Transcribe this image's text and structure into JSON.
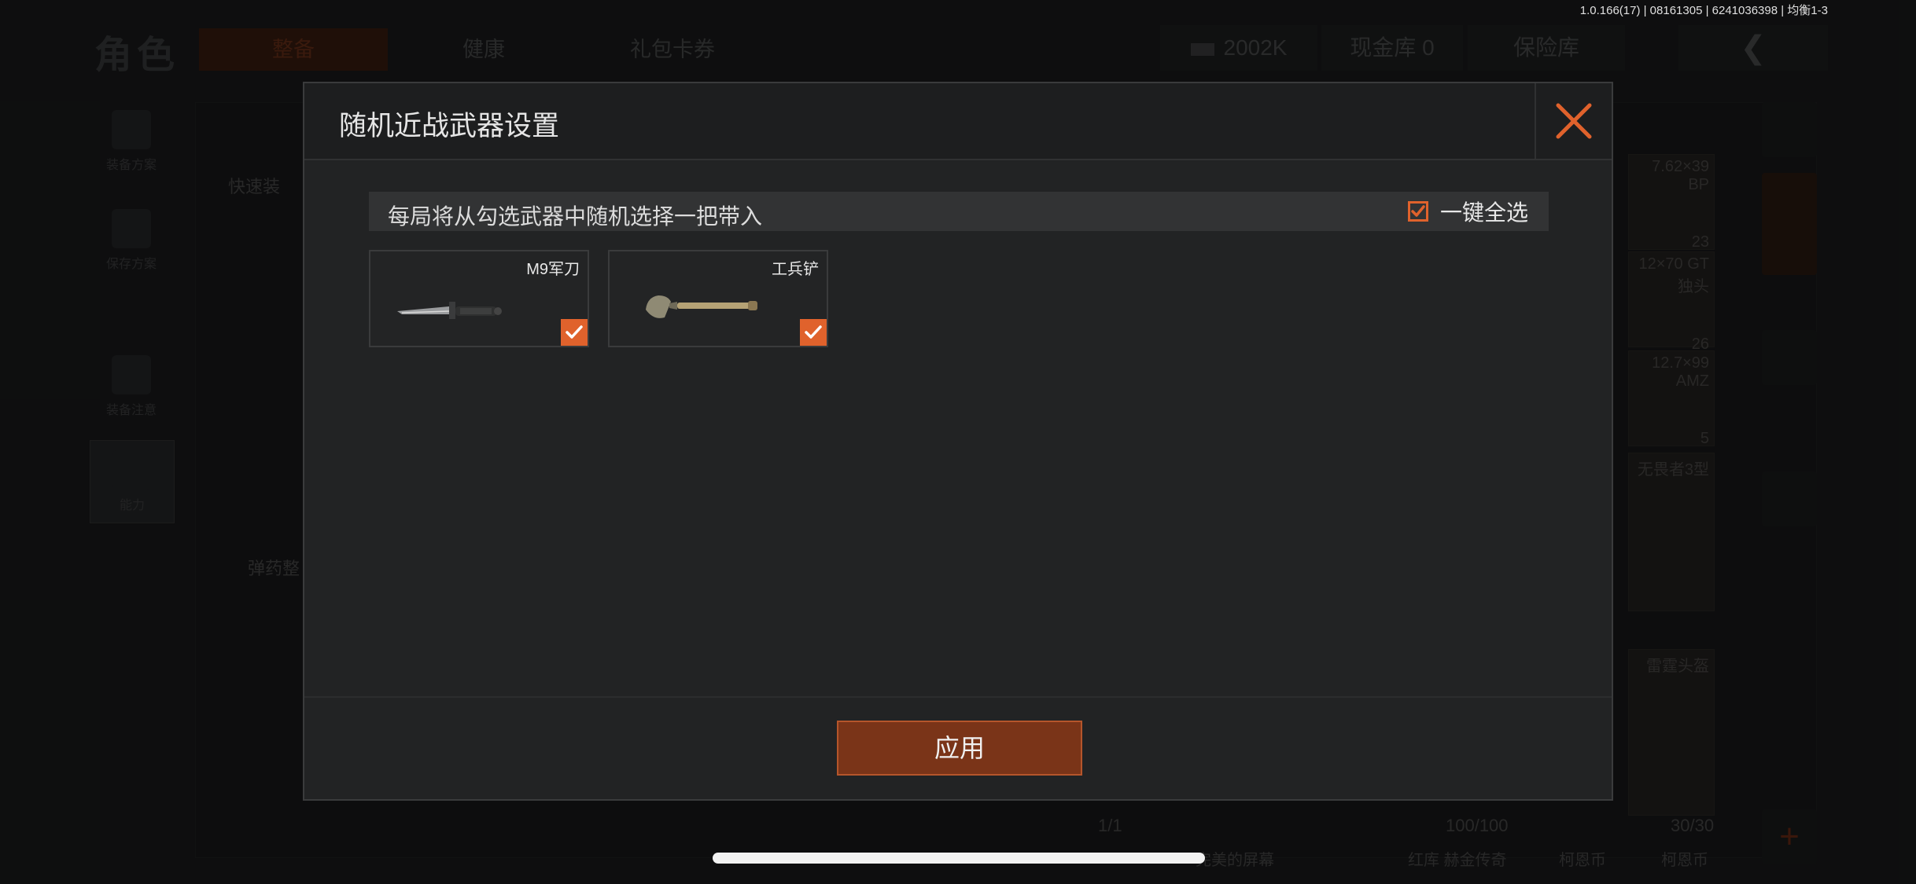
{
  "version": "1.0.166(17) | 08161305 | 6241036398 | 均衡1-3",
  "background": {
    "title": "角色",
    "tabs": [
      "整备",
      "健康",
      "礼包卡券"
    ],
    "currency": "2002K",
    "cash_vault": "现金库 0",
    "insurance": "保险库",
    "left_menu": [
      "装备方案",
      "保存方案",
      "装备注意",
      "能力"
    ],
    "panel_labels": [
      "快速装",
      "弹药整"
    ],
    "items": [
      {
        "label": "7.62×39 BP",
        "count": "23"
      },
      {
        "label": "12×70 GT独头",
        "count": "26"
      },
      {
        "label": "12.7×99 AMZ",
        "count": "5"
      },
      {
        "label": "无畏者3型",
        "count": ""
      },
      {
        "label": "雷霆头盔",
        "count": ""
      }
    ],
    "durability": [
      "1/1",
      "100/100",
      "30/30"
    ],
    "bottom_labels": [
      "完美的屏幕",
      "红库 赫金传奇",
      "柯恩币",
      "柯恩币"
    ]
  },
  "modal": {
    "title": "随机近战武器设置",
    "hint": "每局将从勾选武器中随机选择一把带入",
    "select_all_label": "一键全选",
    "select_all_checked": true,
    "weapons": [
      {
        "name": "M9军刀",
        "checked": true,
        "icon": "knife-icon"
      },
      {
        "name": "工兵铲",
        "checked": true,
        "icon": "shovel-icon"
      }
    ],
    "apply_label": "应用"
  },
  "colors": {
    "accent": "#e0622c",
    "apply_bg": "#7a3418"
  }
}
